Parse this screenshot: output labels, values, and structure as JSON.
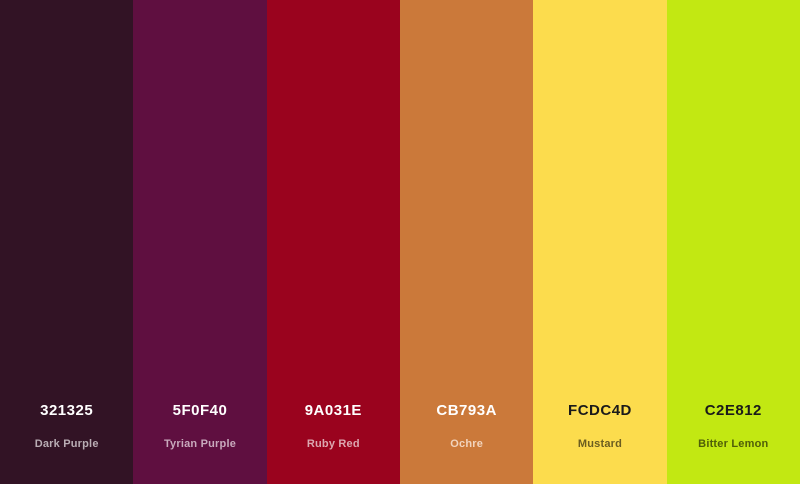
{
  "palette": {
    "swatches": [
      {
        "hex": "321325",
        "name": "Dark Purple",
        "color": "#321325",
        "hex_text_color": "#ffffff",
        "name_text_color": "#b9adb4"
      },
      {
        "hex": "5F0F40",
        "name": "Tyrian Purple",
        "color": "#5F0F40",
        "hex_text_color": "#ffffff",
        "name_text_color": "#c8a9bc"
      },
      {
        "hex": "9A031E",
        "name": "Ruby Red",
        "color": "#9A031E",
        "hex_text_color": "#ffffff",
        "name_text_color": "#dca8b1"
      },
      {
        "hex": "CB793A",
        "name": "Ochre",
        "color": "#CB793A",
        "hex_text_color": "#ffffff",
        "name_text_color": "#f2d4bd"
      },
      {
        "hex": "FCDC4D",
        "name": "Mustard",
        "color": "#FCDC4D",
        "hex_text_color": "#1a1a1a",
        "name_text_color": "#6b5d20"
      },
      {
        "hex": "C2E812",
        "name": "Bitter Lemon",
        "color": "#C2E812",
        "hex_text_color": "#1a1a1a",
        "name_text_color": "#4f5e08"
      }
    ]
  }
}
